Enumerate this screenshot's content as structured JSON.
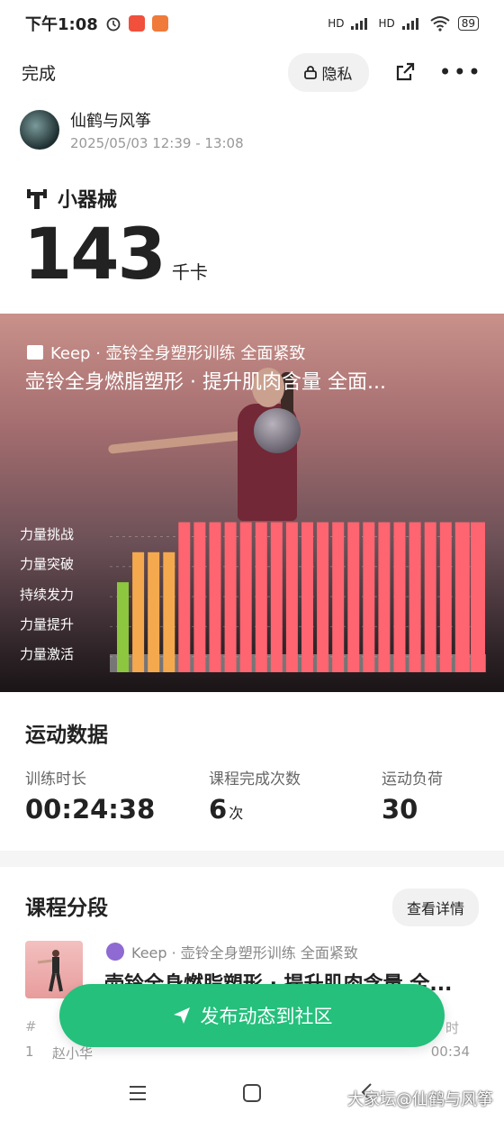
{
  "status_bar": {
    "time": "下午1:08",
    "network_1": "HD",
    "network_2": "HD",
    "battery": "89"
  },
  "nav": {
    "done_label": "完成",
    "privacy_label": "隐私"
  },
  "user": {
    "name": "仙鹤与风筝",
    "time_range": "2025/05/03 12:39 - 13:08"
  },
  "workout": {
    "sport_name": "小器械",
    "calories": "143",
    "calorie_unit": "千卡"
  },
  "hero": {
    "brand_line": "Keep · 壶铃全身塑形训练 全面紧致",
    "course_title": "壶铃全身燃脂塑形 · 提升肌肉含量 全面...",
    "levels": [
      "力量挑战",
      "力量突破",
      "持续发力",
      "力量提升",
      "力量激活"
    ],
    "colors": {
      "green": "#8dc63f",
      "orange": "#f5a94e",
      "red": "#ff6471",
      "gray": "#9a9a9a"
    }
  },
  "chart_data": {
    "type": "bar",
    "description_levels": [
      "力量激活",
      "力量提升",
      "持续发力",
      "力量突破",
      "力量挑战"
    ],
    "values": [
      3,
      4,
      4,
      4,
      5,
      5,
      5,
      5,
      5,
      5,
      5,
      5,
      5,
      5,
      5,
      5,
      5,
      5,
      5,
      5,
      5,
      5,
      5,
      5
    ],
    "ylim": [
      0,
      5
    ]
  },
  "sport_data": {
    "title": "运动数据",
    "stats": [
      {
        "label": "训练时长",
        "value": "00:24:38",
        "unit": ""
      },
      {
        "label": "课程完成次数",
        "value": "6",
        "unit": "次"
      },
      {
        "label": "运动负荷",
        "value": "30",
        "unit": ""
      }
    ]
  },
  "course": {
    "title": "课程分段",
    "details_label": "查看详情",
    "brand_line": "Keep · 壶铃全身塑形训练 全面紧致",
    "name": "壶铃全身燃脂塑形 · 提升肌肉含量 全...",
    "table_head_left": "#",
    "table_head_right": "时",
    "row_index": "1",
    "row_name": "赵小华",
    "row_time": "00:34"
  },
  "publish_label": "发布动态到社区",
  "watermark": "大家坛@仙鹤与风筝"
}
